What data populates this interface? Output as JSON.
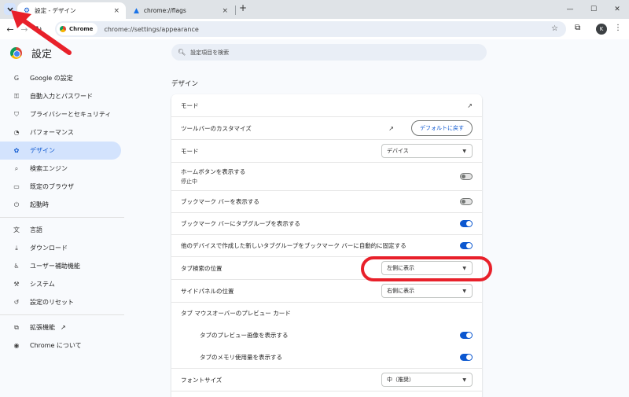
{
  "browser": {
    "active_tab_title": "設定 - デザイン",
    "inactive_tab_title": "chrome://flags",
    "tab_close": "×",
    "new_tab": "+",
    "omnibox_chip": "Chrome",
    "url": "chrome://settings/appearance",
    "profile_initial": "K"
  },
  "settings": {
    "title": "設定",
    "search_placeholder": "設定項目を検索"
  },
  "sidebar": {
    "items": [
      {
        "label": "Google の設定",
        "icon": "google-icon"
      },
      {
        "label": "自動入力とパスワード",
        "icon": "key-icon"
      },
      {
        "label": "プライバシーとセキュリティ",
        "icon": "shield-icon"
      },
      {
        "label": "パフォーマンス",
        "icon": "speedometer-icon"
      },
      {
        "label": "デザイン",
        "icon": "palette-icon",
        "active": true
      },
      {
        "label": "検索エンジン",
        "icon": "search-icon"
      },
      {
        "label": "既定のブラウザ",
        "icon": "browser-icon"
      },
      {
        "label": "起動時",
        "icon": "power-icon"
      },
      {
        "label": "言語",
        "icon": "translate-icon"
      },
      {
        "label": "ダウンロード",
        "icon": "download-icon"
      },
      {
        "label": "ユーザー補助機能",
        "icon": "accessibility-icon"
      },
      {
        "label": "システム",
        "icon": "wrench-icon"
      },
      {
        "label": "設定のリセット",
        "icon": "reset-icon"
      },
      {
        "label": "拡張機能",
        "icon": "puzzle-icon"
      },
      {
        "label": "Chrome について",
        "icon": "chrome-icon"
      }
    ]
  },
  "main": {
    "section_title": "デザイン",
    "rows": {
      "mode_link": "モード",
      "toolbar_customize": "ツールバーのカスタマイズ",
      "reset_button": "デフォルトに戻す",
      "mode": "モード",
      "mode_value": "デバイス",
      "home_button": "ホームボタンを表示する",
      "home_button_sub": "停止中",
      "bookmarks_bar": "ブックマーク バーを表示する",
      "tab_groups_bar": "ブックマーク バーにタブグループを表示する",
      "auto_pin_groups": "他のデバイスで作成した新しいタブグループをブックマーク バーに自動的に固定する",
      "tab_search_position": "タブ検索の位置",
      "tab_search_value": "左側に表示",
      "side_panel_position": "サイドパネルの位置",
      "side_panel_value": "右側に表示",
      "hover_card": "タブ マウスオーバーのプレビュー カード",
      "hover_preview": "タブのプレビュー画像を表示する",
      "hover_memory": "タブのメモリ使用量を表示する",
      "font_size": "フォントサイズ",
      "font_size_value": "中（推奨）"
    },
    "toggles": {
      "home_button": false,
      "bookmarks_bar": false,
      "tab_groups_bar": true,
      "auto_pin_groups": true,
      "hover_preview": true,
      "hover_memory": true
    }
  },
  "colors": {
    "accent": "#0b57d0",
    "annotation": "#e8202a"
  }
}
